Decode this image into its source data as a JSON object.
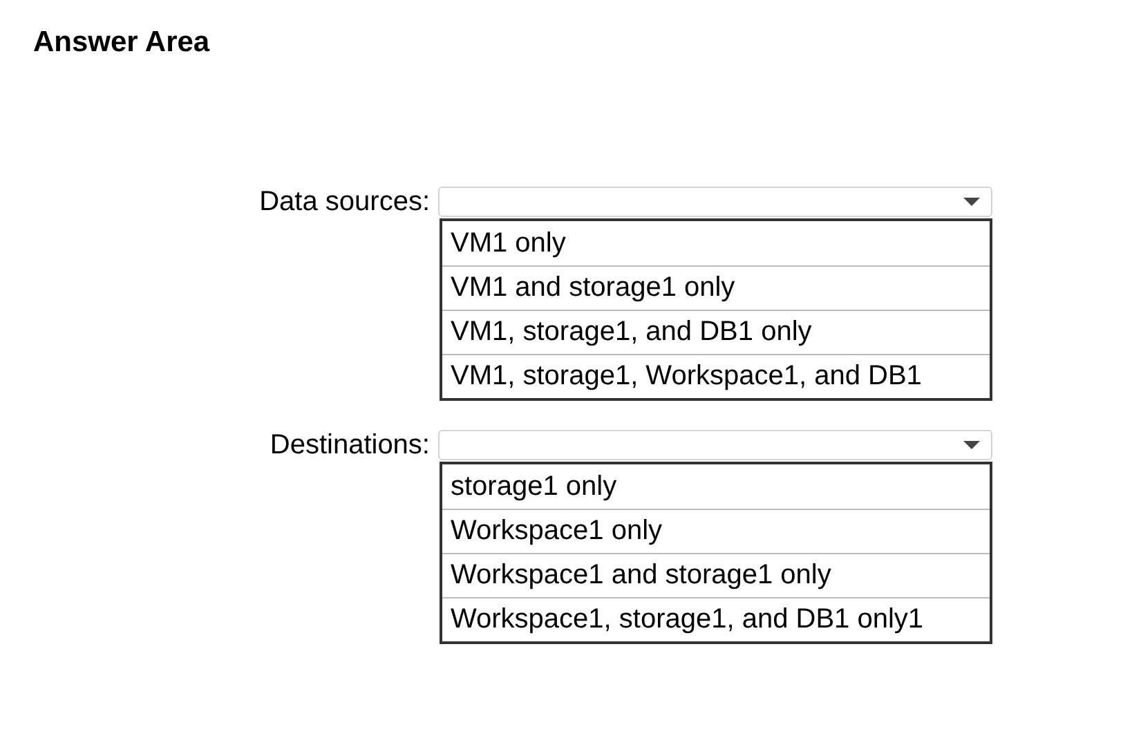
{
  "title": "Answer Area",
  "dropdowns": [
    {
      "label": "Data sources:",
      "options": [
        "VM1 only",
        "VM1 and storage1 only",
        "VM1, storage1, and DB1 only",
        "VM1, storage1, Workspace1, and DB1"
      ]
    },
    {
      "label": "Destinations:",
      "options": [
        "storage1 only",
        "Workspace1 only",
        "Workspace1 and storage1 only",
        "Workspace1, storage1, and DB1 only1"
      ]
    }
  ]
}
